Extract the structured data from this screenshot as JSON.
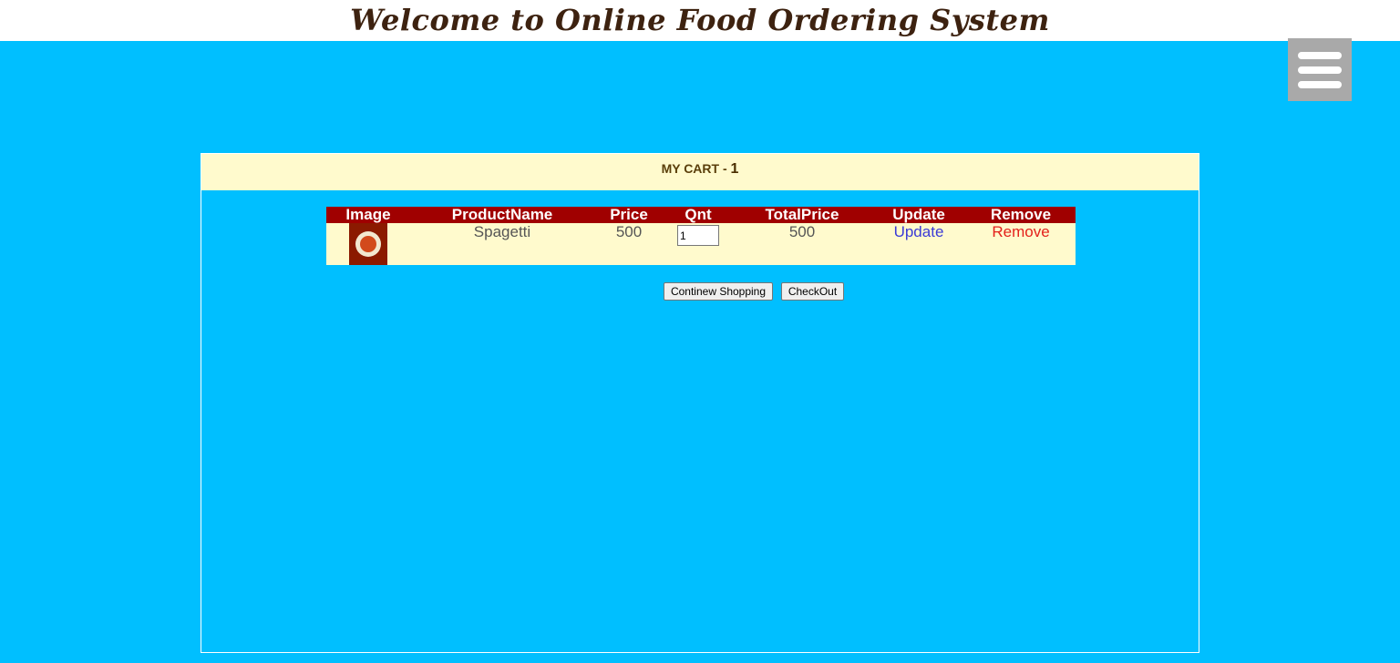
{
  "header": {
    "title": "Welcome to Online Food Ordering System"
  },
  "menu": {
    "icon": "hamburger-menu-icon"
  },
  "cart": {
    "heading": "MY CART - ",
    "count": "1",
    "columns": [
      "Image",
      "ProductName",
      "Price",
      "Qnt",
      "TotalPrice",
      "Update",
      "Remove"
    ],
    "rows": [
      {
        "image_icon": "spaghetti-image",
        "product_name": "Spagetti",
        "price": "500",
        "quantity": "1",
        "total_price": "500",
        "update_label": "Update",
        "remove_label": "Remove"
      }
    ]
  },
  "actions": {
    "continue_label": "Continew Shopping",
    "checkout_label": "CheckOut"
  },
  "colors": {
    "background": "#00bfff",
    "table_header": "#a00000",
    "row_background": "#fffacd",
    "update_link": "#3b3bd6",
    "remove_link": "#e4211b"
  }
}
